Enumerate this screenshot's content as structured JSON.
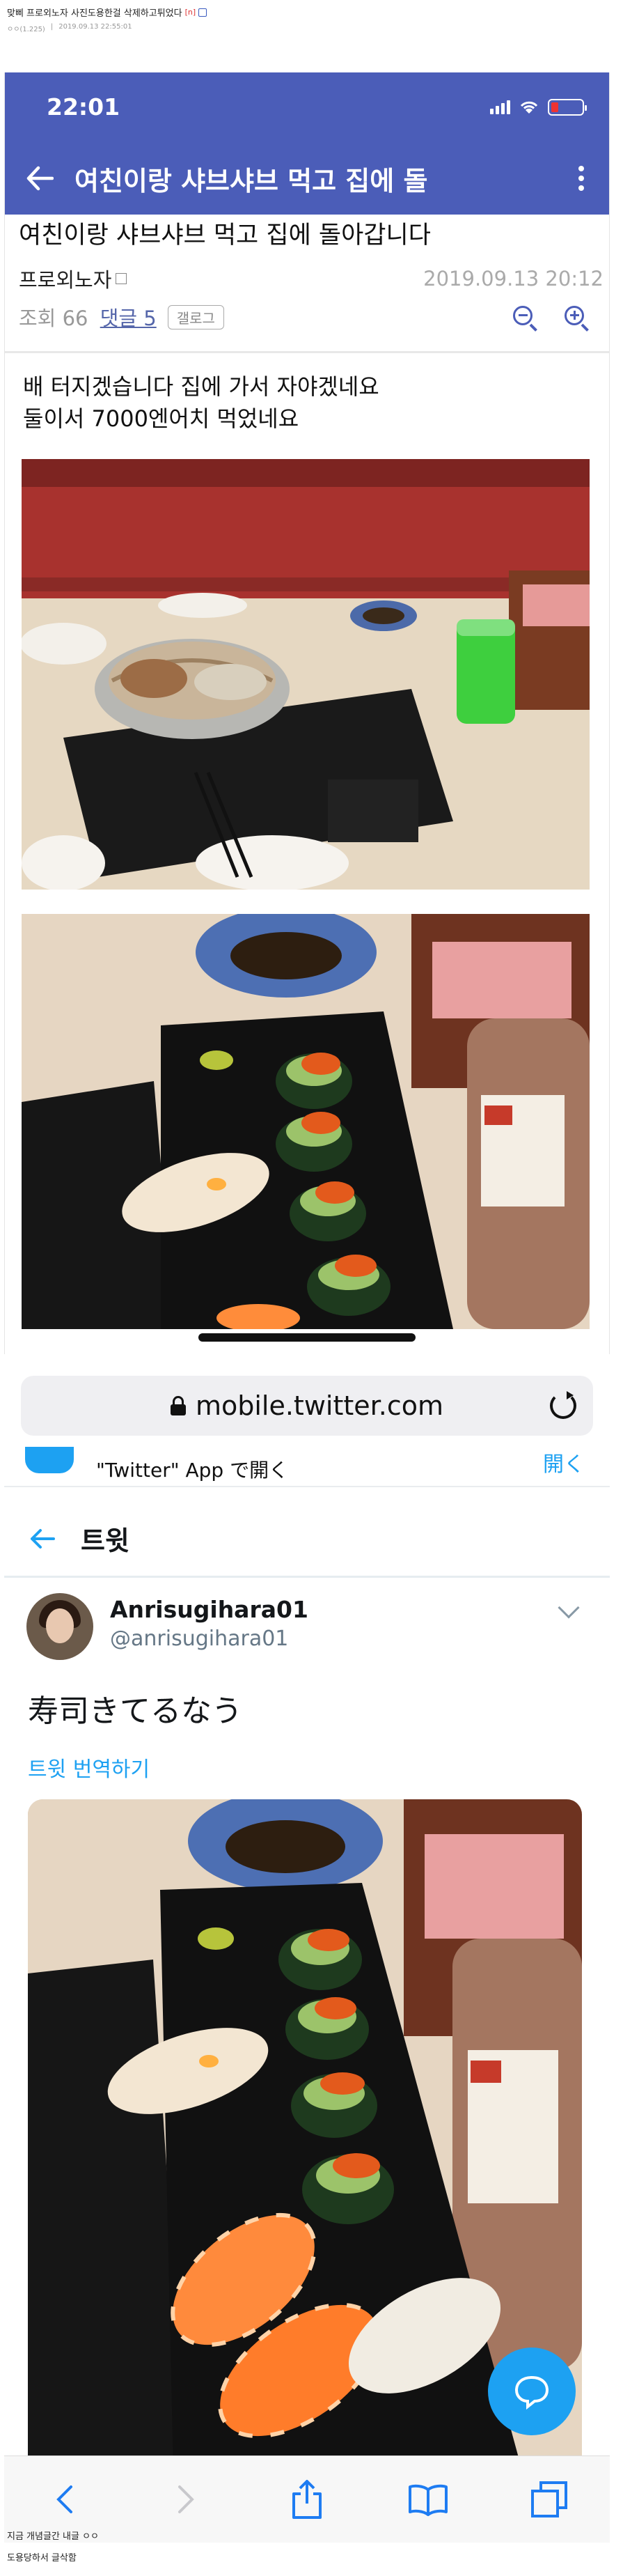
{
  "post": {
    "title": "맞삐 프로외노자 사진도용한걸 삭제하고튀었다",
    "comment_count": "[n]",
    "meta_author": "ㅇㅇ(1.225)",
    "meta_date": "2019.09.13 22:55:01"
  },
  "phone1": {
    "time": "22:01",
    "app_title": "여친이랑 샤브샤브 먹고 집에 돌",
    "article_title": "여친이랑 샤브샤브 먹고 집에 돌아갑니다",
    "author": "프로외노자",
    "date": "2019.09.13 20:12",
    "views": "조회 66",
    "comments": "댓글 5",
    "gallog": "갤로그",
    "body_line1": "배 터지겠습니다 집에 가서 자야겠네요",
    "body_line2": "둘이서 7000엔어치 먹었네요",
    "photo1_alt": "shabu-shabu-hotpot-photo",
    "photo2_alt": "sushi-plate-photo"
  },
  "phone2": {
    "url": "mobile.twitter.com",
    "banner_text": "\"Twitter\" App で開く",
    "banner_open": "開く",
    "nav_title": "트윗",
    "display_name": "Anrisugihara01",
    "handle": "@anrisugihara01",
    "tweet_text": "寿司きてるなう",
    "translate": "트윗 번역하기",
    "photo3_alt": "sushi-plate-photo"
  },
  "footer": {
    "line1": "지금 개념글간 내글 ㅇㅇ",
    "line2": "도용당하서 글삭함"
  },
  "colors": {
    "dc_blue": "#4b5db8",
    "twitter_blue": "#1da1f2"
  }
}
